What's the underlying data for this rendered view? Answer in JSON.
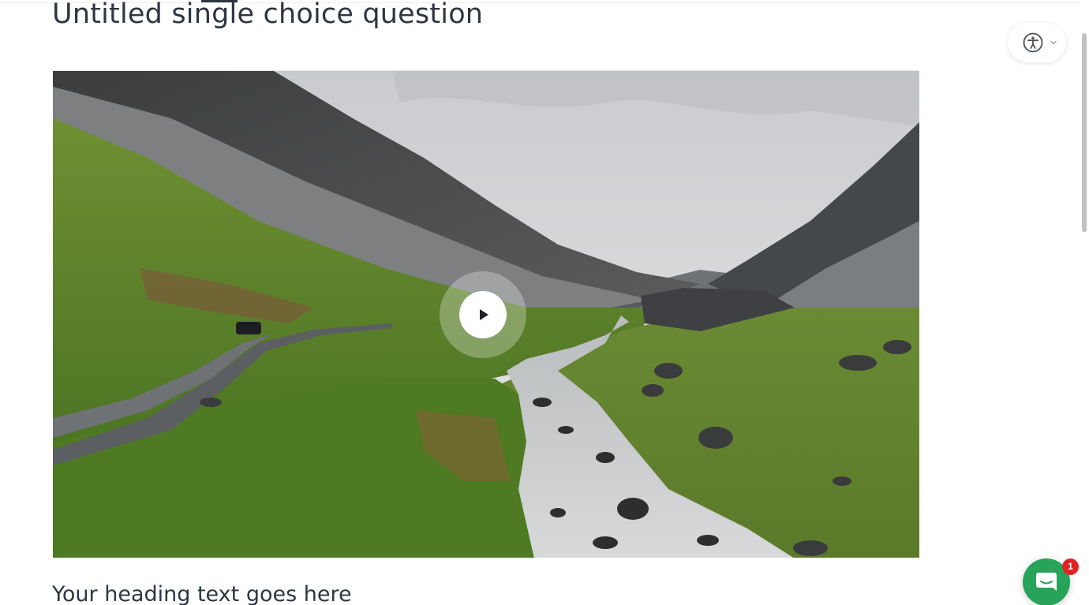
{
  "question": {
    "title": "Untitled single choice question"
  },
  "media": {
    "type": "video",
    "play_icon": "play-icon"
  },
  "section": {
    "heading": "Your heading text goes here"
  },
  "accessibility": {
    "icon": "accessibility-icon",
    "menu_icon": "chevron-down-icon"
  },
  "chat": {
    "icon": "chat-icon",
    "unread_count": "1",
    "color": "#27a35a",
    "badge_color": "#e02424"
  }
}
